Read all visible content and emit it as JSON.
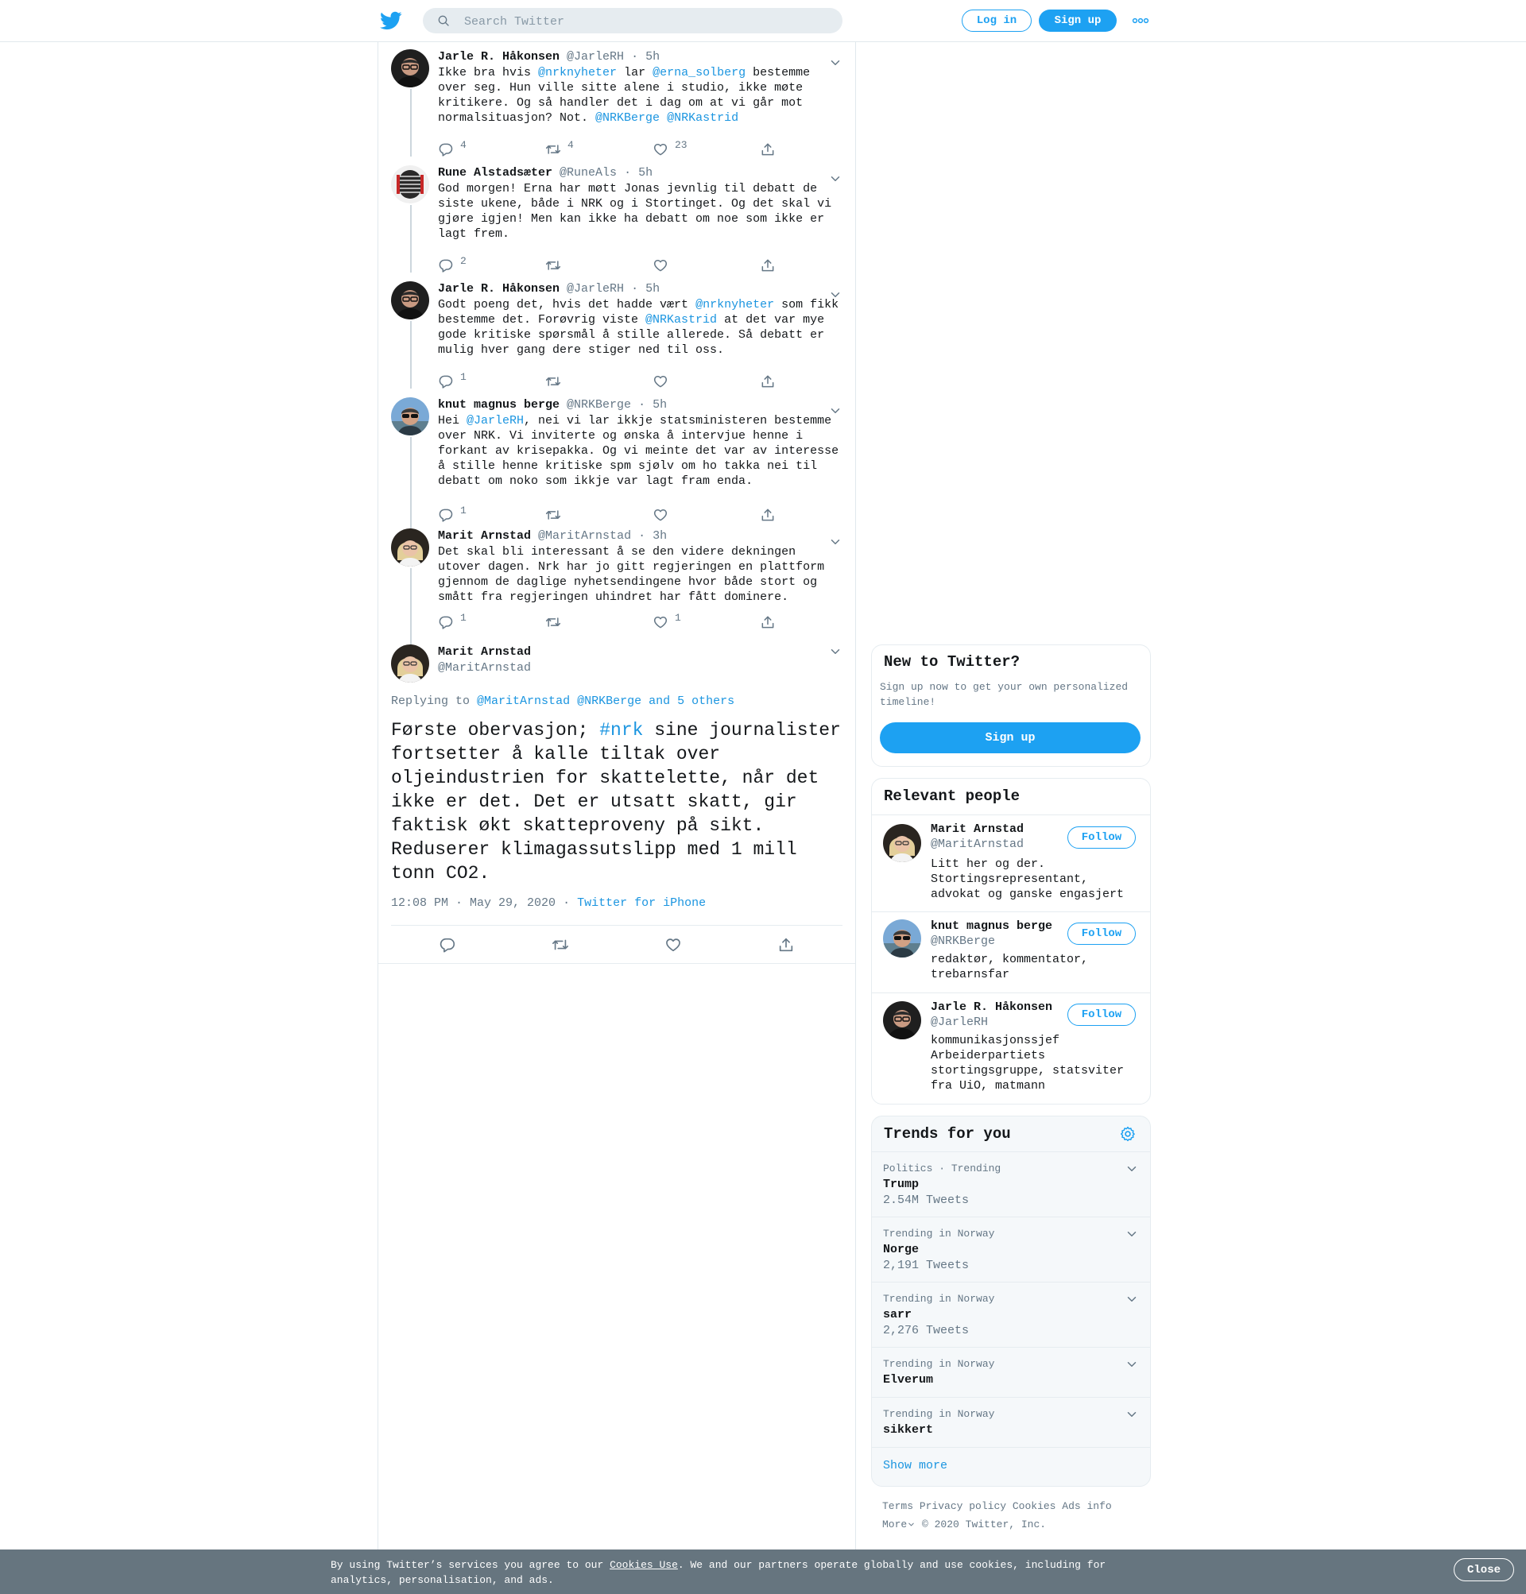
{
  "header": {
    "search_placeholder": "Search Twitter",
    "login_label": "Log in",
    "signup_label": "Sign up"
  },
  "thread": [
    {
      "name": "Jarle R. Håkonsen",
      "handle": "@JarleRH",
      "time": "5h",
      "avatar": "avatar-dark-glasses",
      "text": [
        {
          "t": "Ikke bra hvis "
        },
        {
          "t": "@nrknyheter",
          "link": true
        },
        {
          "t": " lar "
        },
        {
          "t": "@erna_solberg",
          "link": true
        },
        {
          "t": " bestemme over seg. Hun ville sitte alene i studio, ikke møte kritikere. Og så handler det i dag om at vi går mot normalsituasjon? Not. "
        },
        {
          "t": "@NRKBerge",
          "link": true
        },
        {
          "t": " "
        },
        {
          "t": "@NRKastrid",
          "link": true
        }
      ],
      "replies": "4",
      "retweets": "4",
      "likes": "23"
    },
    {
      "name": "Rune Alstadsæter",
      "handle": "@RuneAls",
      "time": "5h",
      "avatar": "avatar-microphone",
      "text": [
        {
          "t": "God morgen! Erna har møtt Jonas jevnlig til debatt de siste ukene, både i NRK og i Stortinget. Og det skal vi gjøre igjen! Men kan ikke ha debatt om noe som ikke er lagt frem."
        }
      ],
      "replies": "2",
      "retweets": "",
      "likes": ""
    },
    {
      "name": "Jarle R. Håkonsen",
      "handle": "@JarleRH",
      "time": "5h",
      "avatar": "avatar-dark-glasses",
      "text": [
        {
          "t": "Godt poeng det, hvis det hadde vært "
        },
        {
          "t": "@nrknyheter",
          "link": true
        },
        {
          "t": " som fikk bestemme det. Forøvrig viste "
        },
        {
          "t": "@NRKastrid",
          "link": true
        },
        {
          "t": " at det var mye gode kritiske spørsmål å stille allerede. Så debatt er mulig hver gang dere stiger ned til oss."
        }
      ],
      "replies": "1",
      "retweets": "",
      "likes": ""
    },
    {
      "name": "knut magnus berge",
      "handle": "@NRKBerge",
      "time": "5h",
      "avatar": "avatar-sunglasses",
      "text": [
        {
          "t": "Hei "
        },
        {
          "t": "@JarleRH",
          "link": true
        },
        {
          "t": ", nei vi lar ikkje statsministeren bestemme over NRK. Vi inviterte og ønska å intervjue henne i forkant av krisepakka. Og vi meinte det var av interesse å stille henne kritiske spm sjølv om ho takka nei til debatt om noko som ikkje var lagt fram enda."
        }
      ],
      "replies": "1",
      "retweets": "",
      "likes": ""
    },
    {
      "name": "Marit Arnstad",
      "handle": "@MaritArnstad",
      "time": "3h",
      "avatar": "avatar-blonde",
      "text": [
        {
          "t": "Det skal bli interessant å se den videre dekningen utover dagen. Nrk har jo gitt regjeringen en plattform gjennom de daglige nyhetsendingene hvor både stort og smått fra regjeringen uhindret har fått dominere."
        }
      ],
      "replies": "1",
      "retweets": "",
      "likes": "1"
    }
  ],
  "focus": {
    "name": "Marit Arnstad",
    "handle": "@MaritArnstad",
    "replying_prefix": "Replying to",
    "replying_to": "@MaritArnstad @NRKBerge and 5 others",
    "text_before": "Første obervasjon; ",
    "hashtag": "#nrk",
    "text_after": " sine journalister fortsetter å kalle tiltak over oljeindustrien for skattelette, når det ikke er det. Det er utsatt skatt, gir faktisk økt skatteproveny på sikt. Reduserer klimagassutslipp med 1 mill tonn CO2.",
    "timestamp": "12:08 PM · May 29, 2020",
    "meta_sep": "·",
    "source": "Twitter for iPhone"
  },
  "new_to_twitter": {
    "title": "New to Twitter?",
    "subtitle": "Sign up now to get your own personalized timeline!",
    "signup_label": "Sign up"
  },
  "relevant_people": {
    "title": "Relevant people",
    "follow_label": "Follow",
    "people": [
      {
        "name": "Marit Arnstad",
        "handle": "@MaritArnstad",
        "bio": "Litt her og der. Stortingsrepresentant, advokat og ganske engasjert"
      },
      {
        "name": "knut magnus berge",
        "handle": "@NRKBerge",
        "bio": "redaktør, kommentator, trebarnsfar"
      },
      {
        "name": "Jarle R. Håkonsen",
        "handle": "@JarleRH",
        "bio": "kommunikasjonssjef Arbeiderpartiets stortingsgruppe, statsviter fra UiO, matmann"
      }
    ]
  },
  "trends": {
    "title": "Trends for you",
    "items": [
      {
        "context": "Politics · Trending",
        "name": "Trump",
        "count": "2.54M Tweets"
      },
      {
        "context": "Trending in Norway",
        "name": "Norge",
        "count": "2,191 Tweets"
      },
      {
        "context": "Trending in Norway",
        "name": "sarr",
        "count": "2,276 Tweets"
      },
      {
        "context": "Trending in Norway",
        "name": "Elverum",
        "count": ""
      },
      {
        "context": "Trending in Norway",
        "name": "sikkert",
        "count": ""
      }
    ],
    "show_more": "Show more"
  },
  "footer": {
    "links": [
      "Terms",
      "Privacy policy",
      "Cookies",
      "Ads info"
    ],
    "more": "More",
    "copyright": "© 2020 Twitter, Inc."
  },
  "cookie_bar": {
    "text_before": "By using Twitter’s services you agree to our ",
    "link": "Cookies Use",
    "text_after": ". We and our partners operate globally and use cookies, including for analytics, personalisation, and ads.",
    "close_label": "Close"
  },
  "colors": {
    "accent": "#1da1f2",
    "link": "#1b95e0",
    "secondary_text": "#657786",
    "cookie_bar": "#66757f"
  }
}
